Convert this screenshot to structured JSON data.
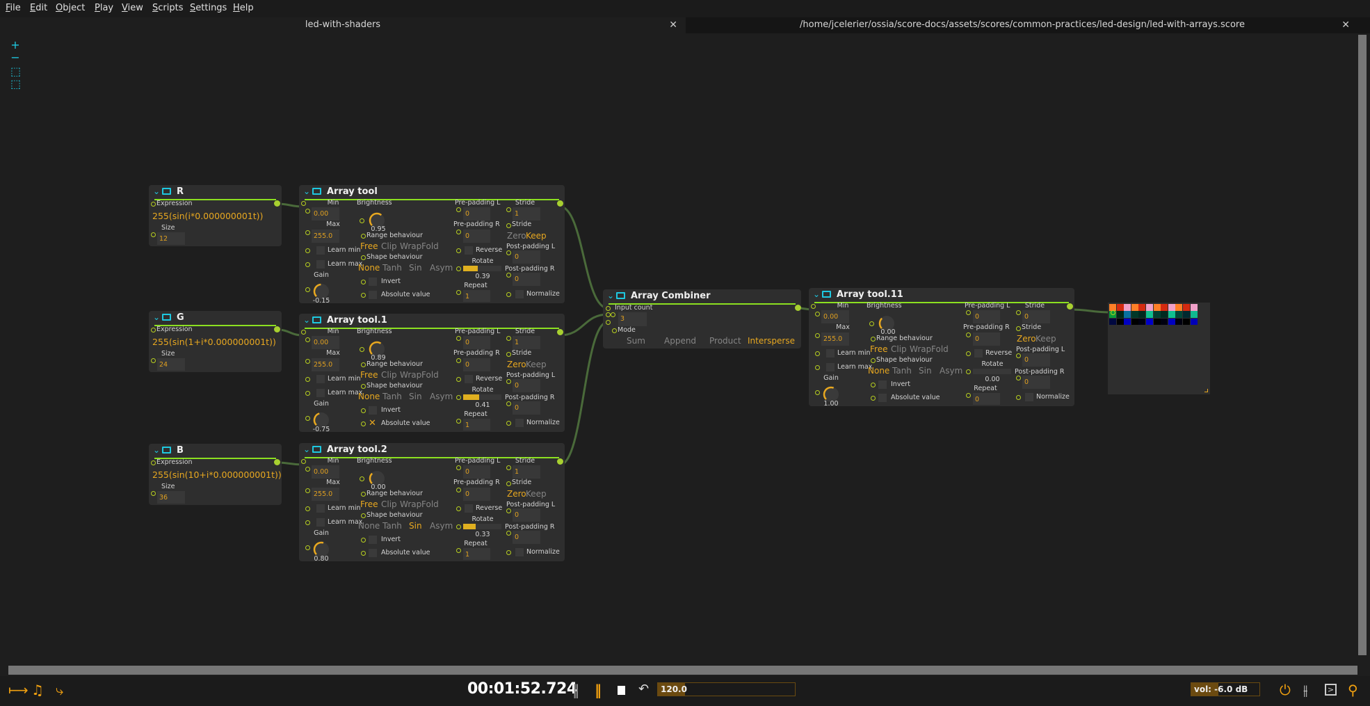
{
  "menu": [
    "File",
    "Edit",
    "Object",
    "Play",
    "View",
    "Scripts",
    "Settings",
    "Help"
  ],
  "tabs": [
    {
      "label": "led-with-shaders",
      "active": true
    },
    {
      "label": "/home/jcelerier/ossia/score-docs/assets/scores/common-practices/led-design/led-with-arrays.score",
      "active": false
    }
  ],
  "zoom_icons": [
    "zoom-in-icon",
    "zoom-out-icon",
    "fit-all-icon",
    "fit-selection-icon"
  ],
  "labels": {
    "expression": "Expression",
    "size": "Size",
    "min": "Min",
    "max": "Max",
    "learn_min": "Learn min",
    "learn_max": "Learn max",
    "gain": "Gain",
    "brightness": "Brightness",
    "range_behaviour": "Range behaviour",
    "shape_behaviour": "Shape behaviour",
    "invert": "Invert",
    "absolute_value": "Absolute value",
    "pre_padding_l": "Pre-padding L",
    "pre_padding_r": "Pre-padding R",
    "reverse": "Reverse",
    "rotate": "Rotate",
    "repeat": "Repeat",
    "stride": "Stride",
    "post_padding_l": "Post-padding L",
    "post_padding_r": "Post-padding R",
    "normalize": "Normalize",
    "input_count": "Input count",
    "mode": "Mode"
  },
  "range_options": [
    "Free",
    "Clip",
    "Wrap",
    "Fold"
  ],
  "shape_options": [
    "None",
    "Tanh",
    "Sin",
    "Asym"
  ],
  "stride_options": [
    "Zero",
    "Keep"
  ],
  "combine_modes": [
    "Sum",
    "Append",
    "Product",
    "Intersperse"
  ],
  "expression_nodes": [
    {
      "title": "R",
      "expression": "255(sin(i*0.000000001t))",
      "size": "12"
    },
    {
      "title": "G",
      "expression": "255(sin(1+i*0.000000001t))",
      "size": "24"
    },
    {
      "title": "B",
      "expression": "255(sin(10+i*0.000000001t))",
      "size": "36"
    }
  ],
  "array_tools": [
    {
      "title": "Array tool",
      "min": "0.00",
      "max": "255.0",
      "brightness": "0.95",
      "range": "Free",
      "shape": "None",
      "gain": "-0.15",
      "pre_l": "0",
      "pre_r": "0",
      "stride": "1",
      "stride_mode": "Keep",
      "rotate": "0.39",
      "repeat": "1",
      "post_l": "0",
      "post_r": "0",
      "absolute": false
    },
    {
      "title": "Array tool.1",
      "min": "0.00",
      "max": "255.0",
      "brightness": "0.89",
      "range": "Free",
      "shape": "None",
      "gain": "-0.75",
      "pre_l": "0",
      "pre_r": "0",
      "stride": "1",
      "stride_mode": "Zero",
      "rotate": "0.41",
      "repeat": "1",
      "post_l": "0",
      "post_r": "0",
      "absolute": true
    },
    {
      "title": "Array tool.2",
      "min": "0.00",
      "max": "255.0",
      "brightness": "0.00",
      "range": "Free",
      "shape": "Sin",
      "gain": "0.80",
      "pre_l": "0",
      "pre_r": "0",
      "stride": "1",
      "stride_mode": "Zero",
      "rotate": "0.33",
      "repeat": "1",
      "post_l": "0",
      "post_r": "0",
      "absolute": false
    },
    {
      "title": "Array tool.11",
      "min": "0.00",
      "max": "255.0",
      "brightness": "0.00",
      "range": "Free",
      "shape": "None",
      "gain": "1.00",
      "pre_l": "0",
      "pre_r": "0",
      "stride": "0",
      "stride_mode": "Zero",
      "rotate": "0.00",
      "repeat": "0",
      "post_l": "0",
      "post_r": "0",
      "absolute": false
    }
  ],
  "combiner": {
    "title": "Array Combiner",
    "input_count": "3",
    "mode": "Intersperse"
  },
  "led_view": {
    "rows": [
      [
        "#ff7f27",
        "#d42a10",
        "#f0a0c8",
        "#ff7f27",
        "#d42a10",
        "#f0a0c8",
        "#ff7f27",
        "#d42a10",
        "#f0a0c8",
        "#ff7f27",
        "#d42a10",
        "#f0a0c8"
      ],
      [
        "#0a9a3a",
        "#002818",
        "#0870a0",
        "#003828",
        "#002a20",
        "#10c090",
        "#004030",
        "#002a20",
        "#10c090",
        "#004838",
        "#002a30",
        "#10b890"
      ],
      [
        "#000840",
        "#000000",
        "#0000c0",
        "#000000",
        "#000010",
        "#0000c8",
        "#000000",
        "#000010",
        "#0000c0",
        "#000010",
        "#000000",
        "#0000b8"
      ]
    ]
  },
  "transport": {
    "time": "00:01:52.724",
    "tempo": "120.0",
    "tempo_fraction": 0.2,
    "volume": "vol: -6.0 dB",
    "volume_fraction": 0.4
  },
  "colors": {
    "accent": "#e8a820",
    "cable": "#4a6a3a",
    "port": "#b8d020",
    "header_line": "#8ce020",
    "icon": "#1ec8e0"
  }
}
